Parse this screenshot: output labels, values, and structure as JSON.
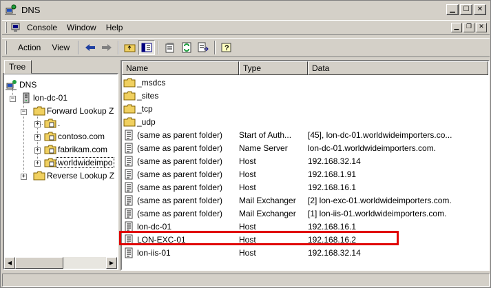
{
  "window": {
    "title": "DNS"
  },
  "menubar": {
    "items": [
      "Console",
      "Window",
      "Help"
    ]
  },
  "toolbar": {
    "menus": [
      "Action",
      "View"
    ]
  },
  "tree": {
    "tab_label": "Tree",
    "nodes": [
      "DNS",
      "lon-dc-01",
      "Forward Lookup Z",
      ".",
      "contoso.com",
      "fabrikam.com",
      "worldwideimpo",
      "Reverse Lookup Z"
    ]
  },
  "list": {
    "columns": [
      "Name",
      "Type",
      "Data"
    ],
    "rows": [
      {
        "icon": "folder-icon",
        "name": "_msdcs",
        "type": "",
        "data": ""
      },
      {
        "icon": "folder-icon",
        "name": "_sites",
        "type": "",
        "data": ""
      },
      {
        "icon": "folder-icon",
        "name": "_tcp",
        "type": "",
        "data": ""
      },
      {
        "icon": "folder-icon",
        "name": "_udp",
        "type": "",
        "data": ""
      },
      {
        "icon": "record-icon",
        "name": "(same as parent folder)",
        "type": "Start of Auth...",
        "data": "[45], lon-dc-01.worldwideimporters.co..."
      },
      {
        "icon": "record-icon",
        "name": "(same as parent folder)",
        "type": "Name Server",
        "data": "lon-dc-01.worldwideimporters.com."
      },
      {
        "icon": "record-icon",
        "name": "(same as parent folder)",
        "type": "Host",
        "data": "192.168.32.14"
      },
      {
        "icon": "record-icon",
        "name": "(same as parent folder)",
        "type": "Host",
        "data": "192.168.1.91"
      },
      {
        "icon": "record-icon",
        "name": "(same as parent folder)",
        "type": "Host",
        "data": "192.168.16.1"
      },
      {
        "icon": "record-icon",
        "name": "(same as parent folder)",
        "type": "Mail Exchanger",
        "data": "[2]  lon-exc-01.worldwideimporters.com."
      },
      {
        "icon": "record-icon",
        "name": "(same as parent folder)",
        "type": "Mail Exchanger",
        "data": "[1]  lon-iis-01.worldwideimporters.com."
      },
      {
        "icon": "record-icon",
        "name": "lon-dc-01",
        "type": "Host",
        "data": "192.168.16.1"
      },
      {
        "icon": "record-icon",
        "name": "LON-EXC-01",
        "type": "Host",
        "data": "192.168.16.2"
      },
      {
        "icon": "record-icon",
        "name": "lon-iis-01",
        "type": "Host",
        "data": "192.168.32.14"
      }
    ]
  },
  "colors": {
    "highlight_box": "#e00000",
    "chrome": "#d4d0c8"
  }
}
